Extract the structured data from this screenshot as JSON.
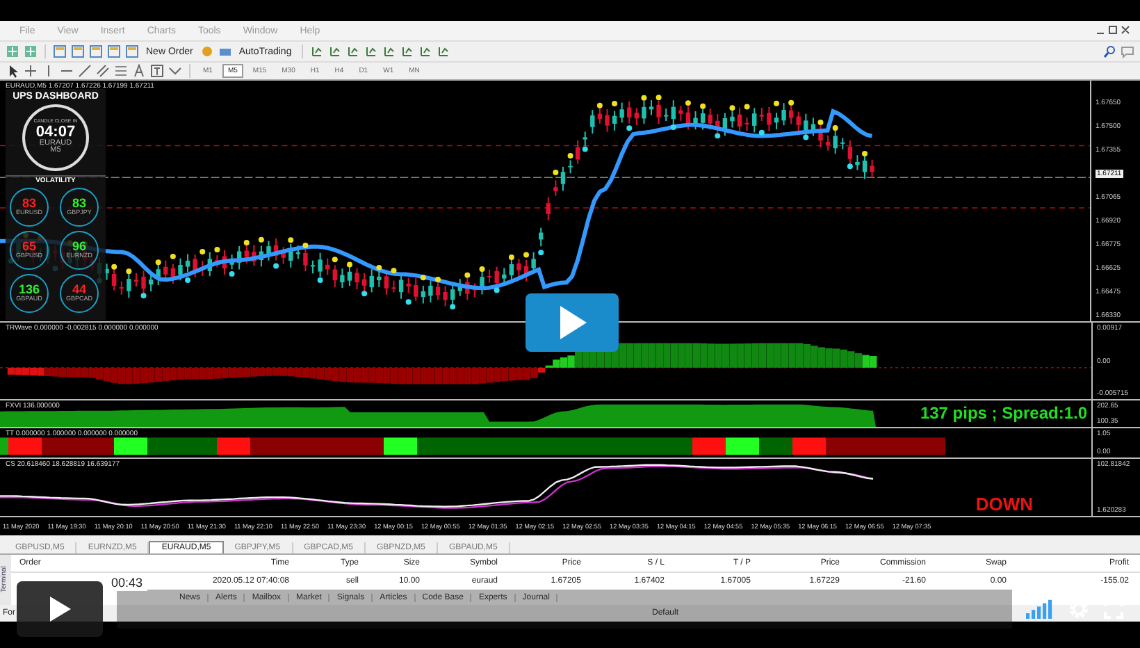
{
  "menu": [
    "File",
    "View",
    "Insert",
    "Charts",
    "Tools",
    "Window",
    "Help"
  ],
  "toolbar": {
    "new_order": "New Order",
    "auto_trading": "AutoTrading"
  },
  "timeframes": [
    {
      "label": "M1",
      "selected": false
    },
    {
      "label": "M5",
      "selected": true
    },
    {
      "label": "M15",
      "selected": false
    },
    {
      "label": "M30",
      "selected": false
    },
    {
      "label": "H1",
      "selected": false
    },
    {
      "label": "H4",
      "selected": false
    },
    {
      "label": "D1",
      "selected": false
    },
    {
      "label": "W1",
      "selected": false
    },
    {
      "label": "MN",
      "selected": false
    }
  ],
  "chart": {
    "title": "EURAUD,M5  1.67207 1.67226 1.67199 1.67211",
    "price_axis": [
      {
        "label": "1.67650",
        "current": false
      },
      {
        "label": "1.67500",
        "current": false
      },
      {
        "label": "1.67355",
        "current": false
      },
      {
        "label": "1.67211",
        "current": true
      },
      {
        "label": "1.67065",
        "current": false
      },
      {
        "label": "1.66920",
        "current": false
      },
      {
        "label": "1.66775",
        "current": false
      },
      {
        "label": "1.66625",
        "current": false
      },
      {
        "label": "1.66475",
        "current": false
      },
      {
        "label": "1.66330",
        "current": false
      }
    ],
    "dashboard": {
      "title": "UPS DASHBOARD",
      "clock_caption": "CANDLE CLOSE IN",
      "countdown": "04:07",
      "symbol": "EURAUD",
      "period": "M5",
      "section": "VOLATILITY",
      "pairs": [
        {
          "value": "83",
          "symbol": "EURUSD",
          "color": "#ff2020"
        },
        {
          "value": "83",
          "symbol": "GBPJPY",
          "color": "#33ee33"
        },
        {
          "value": "65",
          "symbol": "GBPUSD",
          "color": "#ff2020"
        },
        {
          "value": "96",
          "symbol": "EURNZD",
          "color": "#33ee33"
        },
        {
          "value": "136",
          "symbol": "GBPAUD",
          "color": "#33ee33"
        },
        {
          "value": "44",
          "symbol": "GBPCAD",
          "color": "#ff2020"
        }
      ]
    },
    "panes": [
      {
        "kind": "wave",
        "title": "TRWave 0.000000 -0.002815 0.000000 0.000000",
        "axis": [
          "0.00917",
          "0.00",
          "-0.005715"
        ]
      },
      {
        "kind": "area",
        "title": "FXVI 136.000000",
        "axis": [
          "202.65",
          "100.35"
        ],
        "note": "137 pips ; Spread:1.0"
      },
      {
        "kind": "blocks",
        "title": "TT 0.000000 1.000000 0.000000 0.000000",
        "axis": [
          "1.05",
          "0.00"
        ]
      },
      {
        "kind": "lines",
        "title": "CS 20.618460 18.628819 16.639177",
        "axis": [
          "102.81842",
          "1.620283"
        ],
        "note": "DOWN"
      }
    ],
    "time_axis": [
      "11 May 2020",
      "11 May 19:30",
      "11 May 20:10",
      "11 May 20:50",
      "11 May 21:30",
      "11 May 22:10",
      "11 May 22:50",
      "11 May 23:30",
      "12 May 00:15",
      "12 May 00:55",
      "12 May 01:35",
      "12 May 02:15",
      "12 May 02:55",
      "12 May 03:35",
      "12 May 04:15",
      "12 May 04:55",
      "12 May 05:35",
      "12 May 06:15",
      "12 May 06:55",
      "12 May 07:35"
    ]
  },
  "chart_tabs": [
    {
      "label": "GBPUSD,M5",
      "selected": false
    },
    {
      "label": "EURNZD,M5",
      "selected": false
    },
    {
      "label": "EURAUD,M5",
      "selected": true
    },
    {
      "label": "GBPJPY,M5",
      "selected": false
    },
    {
      "label": "GBPCAD,M5",
      "selected": false
    },
    {
      "label": "GBPNZD,M5",
      "selected": false
    },
    {
      "label": "GBPAUD,M5",
      "selected": false
    }
  ],
  "terminal": {
    "side_label": "Terminal",
    "columns": [
      "Order",
      "Time",
      "Type",
      "Size",
      "Symbol",
      "Price",
      "S / L",
      "T / P",
      "Price",
      "Commission",
      "Swap",
      "Profit"
    ],
    "rows": [
      [
        "",
        "2020.05.12 07:40:08",
        "sell",
        "10.00",
        "euraud",
        "1.67205",
        "1.67402",
        "1.67005",
        "1.67229",
        "-21.60",
        "0.00",
        "-155.02"
      ]
    ],
    "tabs": [
      "News",
      "Alerts",
      "Mailbox",
      "Market",
      "Signals",
      "Articles",
      "Code Base",
      "Experts",
      "Journal"
    ]
  },
  "status_bar": {
    "help": "For",
    "profile": "Default"
  },
  "video": {
    "time": "00:43"
  }
}
